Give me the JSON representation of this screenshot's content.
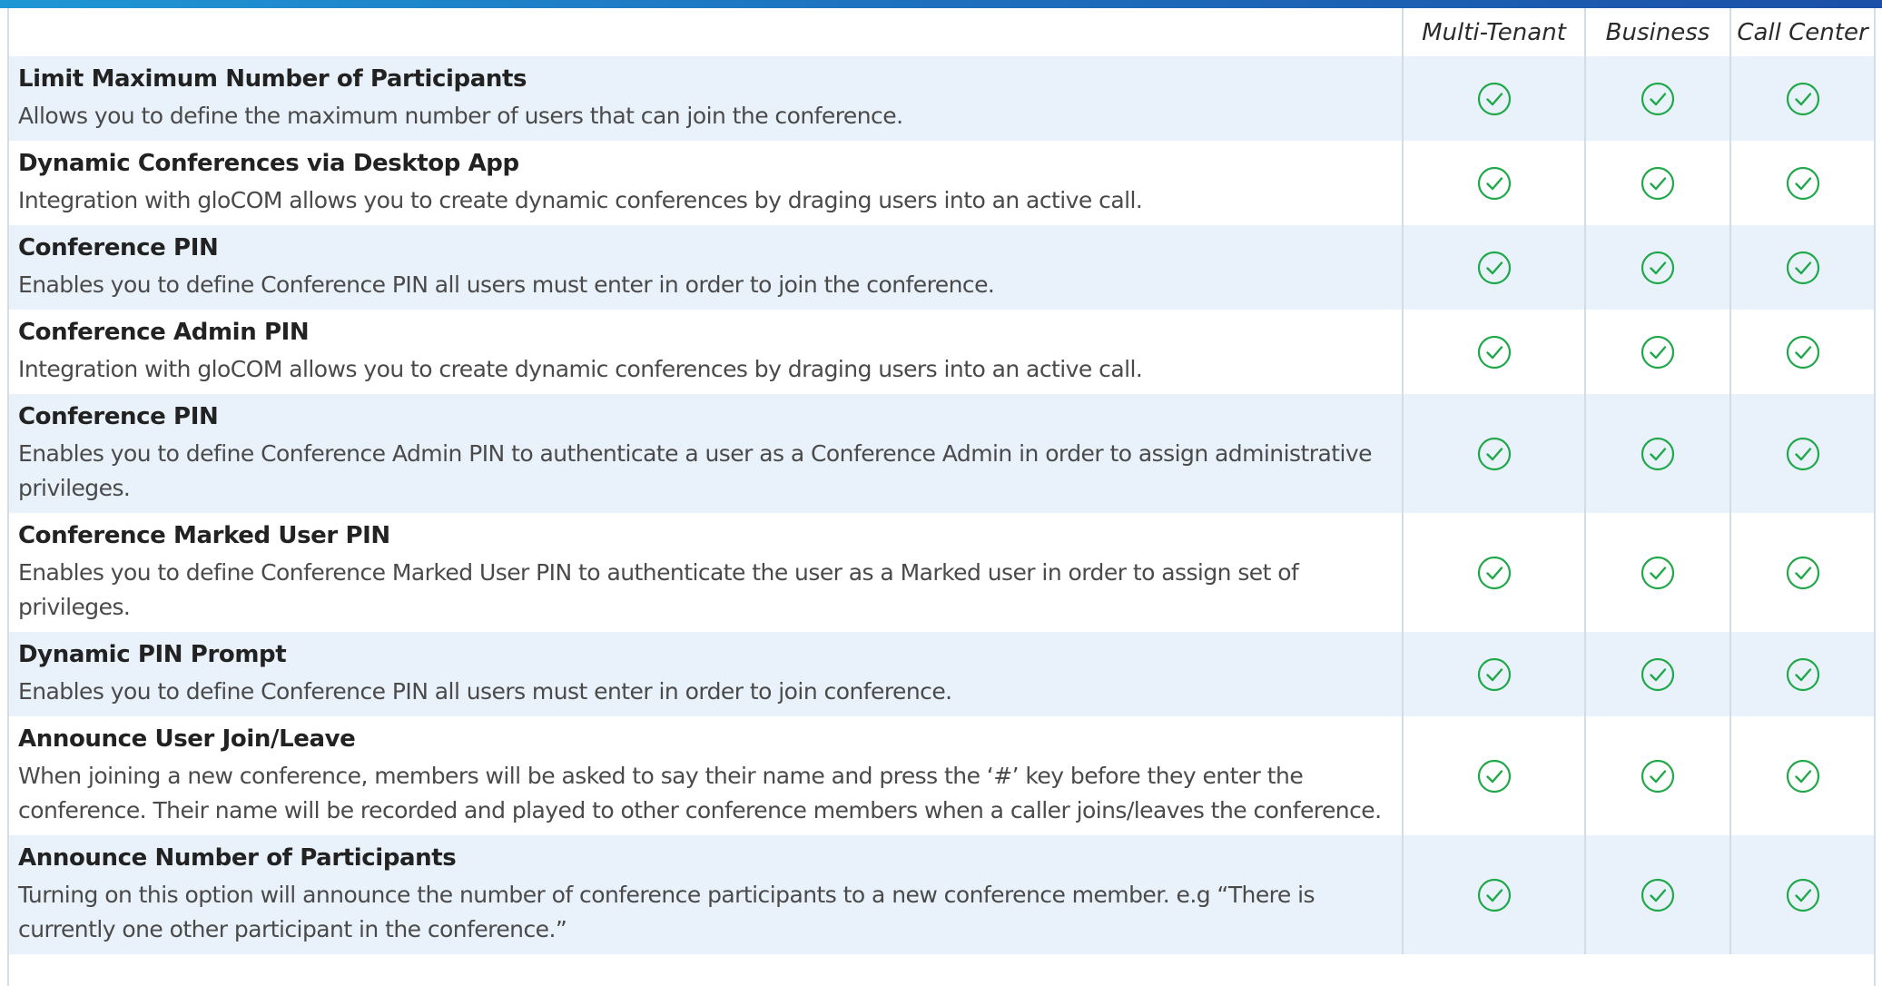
{
  "columns": {
    "multi_tenant": "Multi-Tenant",
    "business": "Business",
    "call_center": "Call Center"
  },
  "check_color": "#20a84a",
  "check_icon": "circle-check-icon",
  "features": [
    {
      "title": "Limit Maximum Number of Participants",
      "description": "Allows you to define the maximum number of users that can join the conference.",
      "multi_tenant": true,
      "business": true,
      "call_center": true
    },
    {
      "title": "Dynamic Conferences via Desktop App",
      "description": "Integration with gloCOM allows you to create dynamic conferences by draging users into an active call.",
      "multi_tenant": true,
      "business": true,
      "call_center": true
    },
    {
      "title": "Conference PIN",
      "description": "Enables you to define Conference PIN all users must enter in order to join the conference.",
      "multi_tenant": true,
      "business": true,
      "call_center": true
    },
    {
      "title": "Conference Admin PIN",
      "description": "Integration with gloCOM allows you to create dynamic conferences by draging users into an active call.",
      "multi_tenant": true,
      "business": true,
      "call_center": true
    },
    {
      "title": "Conference PIN",
      "description": "Enables you to define Conference Admin PIN to authenticate a user as a Conference Admin in order to assign administrative privileges.",
      "multi_tenant": true,
      "business": true,
      "call_center": true
    },
    {
      "title": "Conference Marked User PIN",
      "description": "Enables you to define Conference Marked User PIN to authenticate the user as a Marked user in order to assign set of privileges.",
      "multi_tenant": true,
      "business": true,
      "call_center": true
    },
    {
      "title": "Dynamic PIN Prompt",
      "description": "Enables you to define Conference PIN all users must enter in order to join conference.",
      "multi_tenant": true,
      "business": true,
      "call_center": true
    },
    {
      "title": "Announce User Join/Leave",
      "description": "When joining a new conference, members will be asked to say their name and press the ‘#’ key before they enter the conference. Their name will be recorded and played to other conference members when a caller joins/leaves the conference.",
      "multi_tenant": true,
      "business": true,
      "call_center": true
    },
    {
      "title": "Announce Number of Participants",
      "description": "Turning on this option will announce the number of conference participants to a new conference member. e.g “There is currently one other participant in the conference.”",
      "multi_tenant": true,
      "business": true,
      "call_center": true
    }
  ]
}
